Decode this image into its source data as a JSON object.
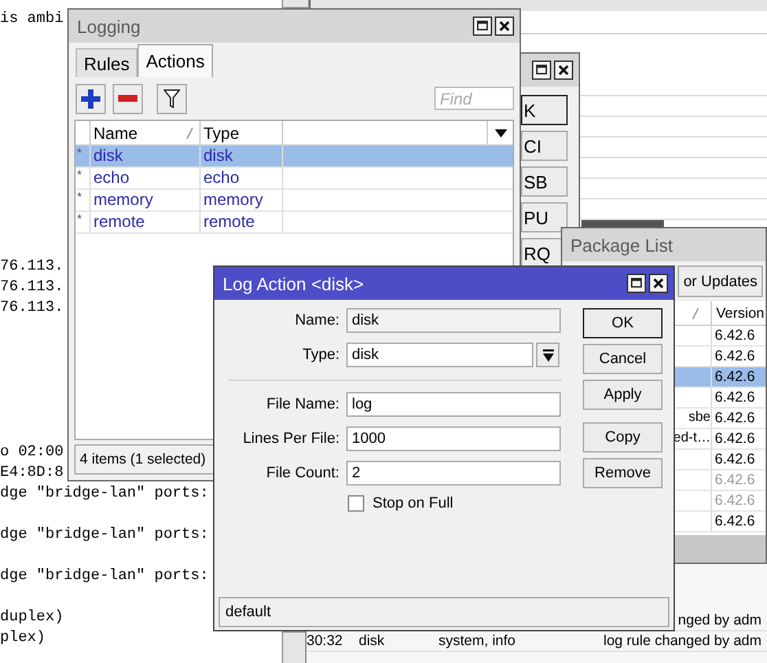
{
  "terminal": {
    "blocks": [
      [
        "is ambi"
      ],
      [
        "76.113.",
        "76.113.",
        "76.113."
      ],
      [
        "o 02:00",
        "E4:8D:8",
        "dge \"bridge-lan\" ports:"
      ],
      [
        "dge \"bridge-lan\" ports:"
      ],
      [
        "dge \"bridge-lan\" ports:"
      ],
      [
        "duplex)",
        "plex)"
      ]
    ]
  },
  "side_window": {
    "buttons": [
      {
        "label": "K",
        "focused": true
      },
      {
        "label": "CI",
        "focused": false
      },
      {
        "label": "SB",
        "focused": false
      },
      {
        "label": "PU",
        "focused": false
      },
      {
        "label": "RQ",
        "focused": false
      }
    ]
  },
  "package_list": {
    "title": "Package List",
    "toolbar_button": "or Updates",
    "version_header": "Version",
    "rows": [
      {
        "version": "6.42.6",
        "selected": false,
        "disabled": false
      },
      {
        "version": "6.42.6",
        "selected": false,
        "disabled": false
      },
      {
        "version": "6.42.6",
        "selected": true,
        "disabled": false
      },
      {
        "version": "6.42.6",
        "selected": false,
        "disabled": false
      },
      {
        "column_1": "sbe",
        "version": "6.42.6",
        "selected": false,
        "disabled": false
      },
      {
        "column_1": "ed-t…",
        "version": "6.42.6",
        "selected": false,
        "disabled": false
      },
      {
        "version": "6.42.6",
        "selected": false,
        "disabled": false
      },
      {
        "version": "6.42.6",
        "selected": false,
        "disabled": true
      },
      {
        "version": "6.42.6",
        "selected": false,
        "disabled": true
      },
      {
        "version": "6.42.6",
        "selected": false,
        "disabled": false
      }
    ]
  },
  "log_window": {
    "rows": [
      {
        "column_4": "nged by adm"
      },
      {
        "column_1": "30:32",
        "column_2": "disk",
        "column_3": "system, info",
        "column_4": "log rule changed by adm"
      }
    ]
  },
  "logging": {
    "title": "Logging",
    "tabs": [
      {
        "label": "Rules",
        "selected": false
      },
      {
        "label": "Actions",
        "selected": true
      }
    ],
    "find": {
      "placeholder": "Find"
    },
    "columns": [
      "Name",
      "Type"
    ],
    "rows": [
      {
        "mark": "*",
        "name": "disk",
        "type": "disk",
        "selected": true
      },
      {
        "mark": "*",
        "name": "echo",
        "type": "echo",
        "selected": false
      },
      {
        "mark": "*",
        "name": "memory",
        "type": "memory",
        "selected": false
      },
      {
        "mark": "*",
        "name": "remote",
        "type": "remote",
        "selected": false
      }
    ],
    "status": "4 items (1 selected)"
  },
  "dialog": {
    "title": "Log Action <disk>",
    "fields": [
      {
        "kind": "readonly",
        "label": "Name:",
        "value": "disk"
      },
      {
        "kind": "dropdown",
        "label": "Type:",
        "value": "disk"
      }
    ],
    "file_fields": [
      {
        "kind": "text",
        "label": "File Name:",
        "value": "log"
      },
      {
        "kind": "text",
        "label": "Lines Per File:",
        "value": "1000"
      },
      {
        "kind": "text",
        "label": "File Count:",
        "value": "2"
      }
    ],
    "checkbox": {
      "label": "Stop on Full",
      "checked": false
    },
    "button_groups": [
      [
        {
          "label": "OK",
          "focused": true
        },
        {
          "label": "Cancel",
          "focused": false
        },
        {
          "label": "Apply",
          "focused": false
        }
      ],
      [
        {
          "label": "Copy",
          "focused": false
        },
        {
          "label": "Remove",
          "focused": false
        }
      ]
    ],
    "status": "default"
  }
}
